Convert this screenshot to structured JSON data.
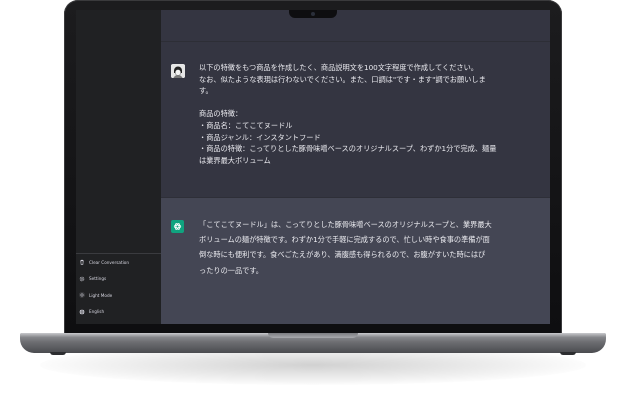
{
  "sidebar": {
    "items": [
      {
        "label": "Clear Conversation",
        "icon": "trash-icon"
      },
      {
        "label": "Settings",
        "icon": "gear-icon"
      },
      {
        "label": "Light Mode",
        "icon": "sun-icon"
      },
      {
        "label": "English",
        "icon": "globe-icon"
      }
    ]
  },
  "chat": {
    "user_message": "以下の特徴をもつ商品を作成したく、商品説明文を100文字程度で作成してください。\nなお、似たような表現は行わないでください。また、口調は\"です・ます\"調でお願いしま\nす。\n\n商品の特徴：\n・商品名：こてこてヌードル\n・商品ジャンル：インスタントフード\n・商品の特徴：こってりとした豚骨味噌ベースのオリジナルスープ、わずか1分で完成、麺量\nは業界最大ボリューム",
    "assistant_message": "「こてこてヌードル」は、こってりとした豚骨味噌ベースのオリジナルスープと、業界最大\nボリュームの麺が特徴です。わずか1分で手軽に完成するので、忙しい時や食事の準備が面\n倒な時にも便利です。食べごたえがあり、満腹感も得られるので、お腹がすいた時にはぴ\nったりの一品です。"
  },
  "colors": {
    "sidebar_bg": "#202123",
    "chat_bg": "#343541",
    "assistant_bg": "#444654",
    "accent": "#10a37f"
  }
}
